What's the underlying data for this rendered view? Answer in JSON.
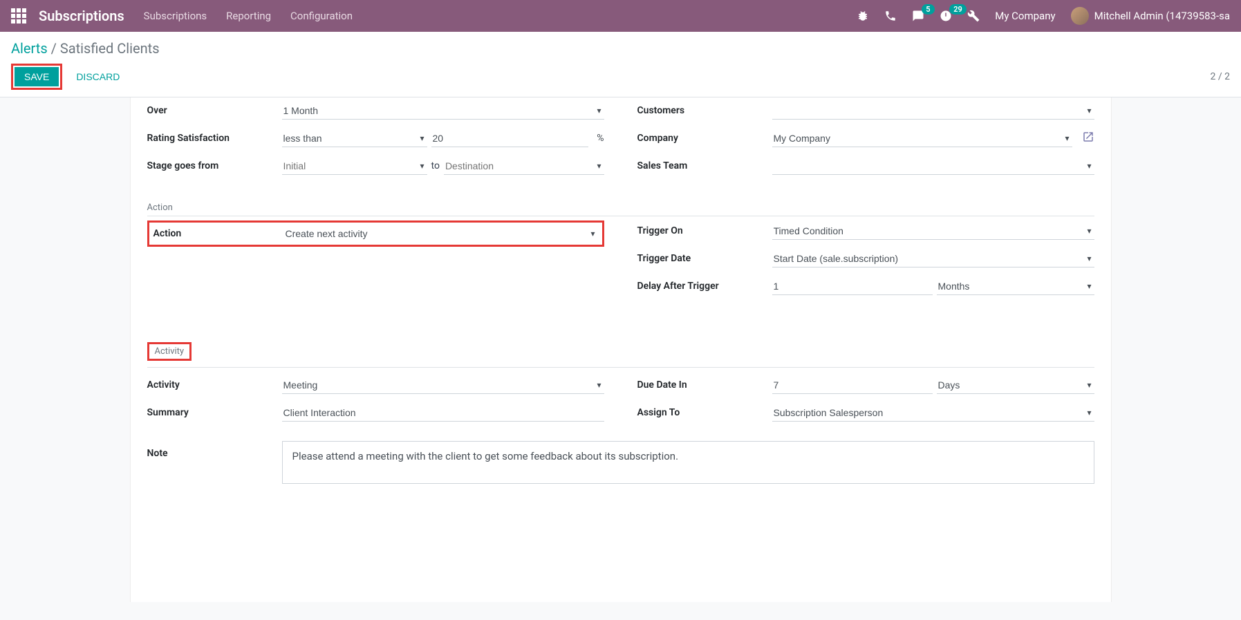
{
  "navbar": {
    "brand": "Subscriptions",
    "menu": [
      "Subscriptions",
      "Reporting",
      "Configuration"
    ],
    "messages_count": "5",
    "activities_count": "29",
    "company": "My Company",
    "user": "Mitchell Admin (14739583-sa"
  },
  "breadcrumb": {
    "parent": "Alerts",
    "current": "Satisfied Clients"
  },
  "buttons": {
    "save": "SAVE",
    "discard": "DISCARD"
  },
  "pager": "2 / 2",
  "fields": {
    "over_label": "Over",
    "over_value": "1 Month",
    "rating_label": "Rating Satisfaction",
    "rating_op": "less than",
    "rating_value": "20",
    "pct": "%",
    "stage_label": "Stage goes from",
    "stage_from_ph": "Initial",
    "stage_to": "to",
    "stage_dest_ph": "Destination",
    "customers_label": "Customers",
    "company_label": "Company",
    "company_value": "My Company",
    "salesteam_label": "Sales Team"
  },
  "sections": {
    "action": "Action",
    "activity": "Activity"
  },
  "action": {
    "label": "Action",
    "value": "Create next activity",
    "trigger_on_label": "Trigger On",
    "trigger_on_value": "Timed Condition",
    "trigger_date_label": "Trigger Date",
    "trigger_date_value": "Start Date (sale.subscription)",
    "delay_label": "Delay After Trigger",
    "delay_value": "1",
    "delay_unit": "Months"
  },
  "activity": {
    "type_label": "Activity",
    "type_value": "Meeting",
    "summary_label": "Summary",
    "summary_value": "Client Interaction",
    "due_label": "Due Date In",
    "due_value": "7",
    "due_unit": "Days",
    "assign_label": "Assign To",
    "assign_value": "Subscription Salesperson",
    "note_label": "Note",
    "note_value": "Please attend a meeting with the client to get some feedback about its subscription."
  }
}
